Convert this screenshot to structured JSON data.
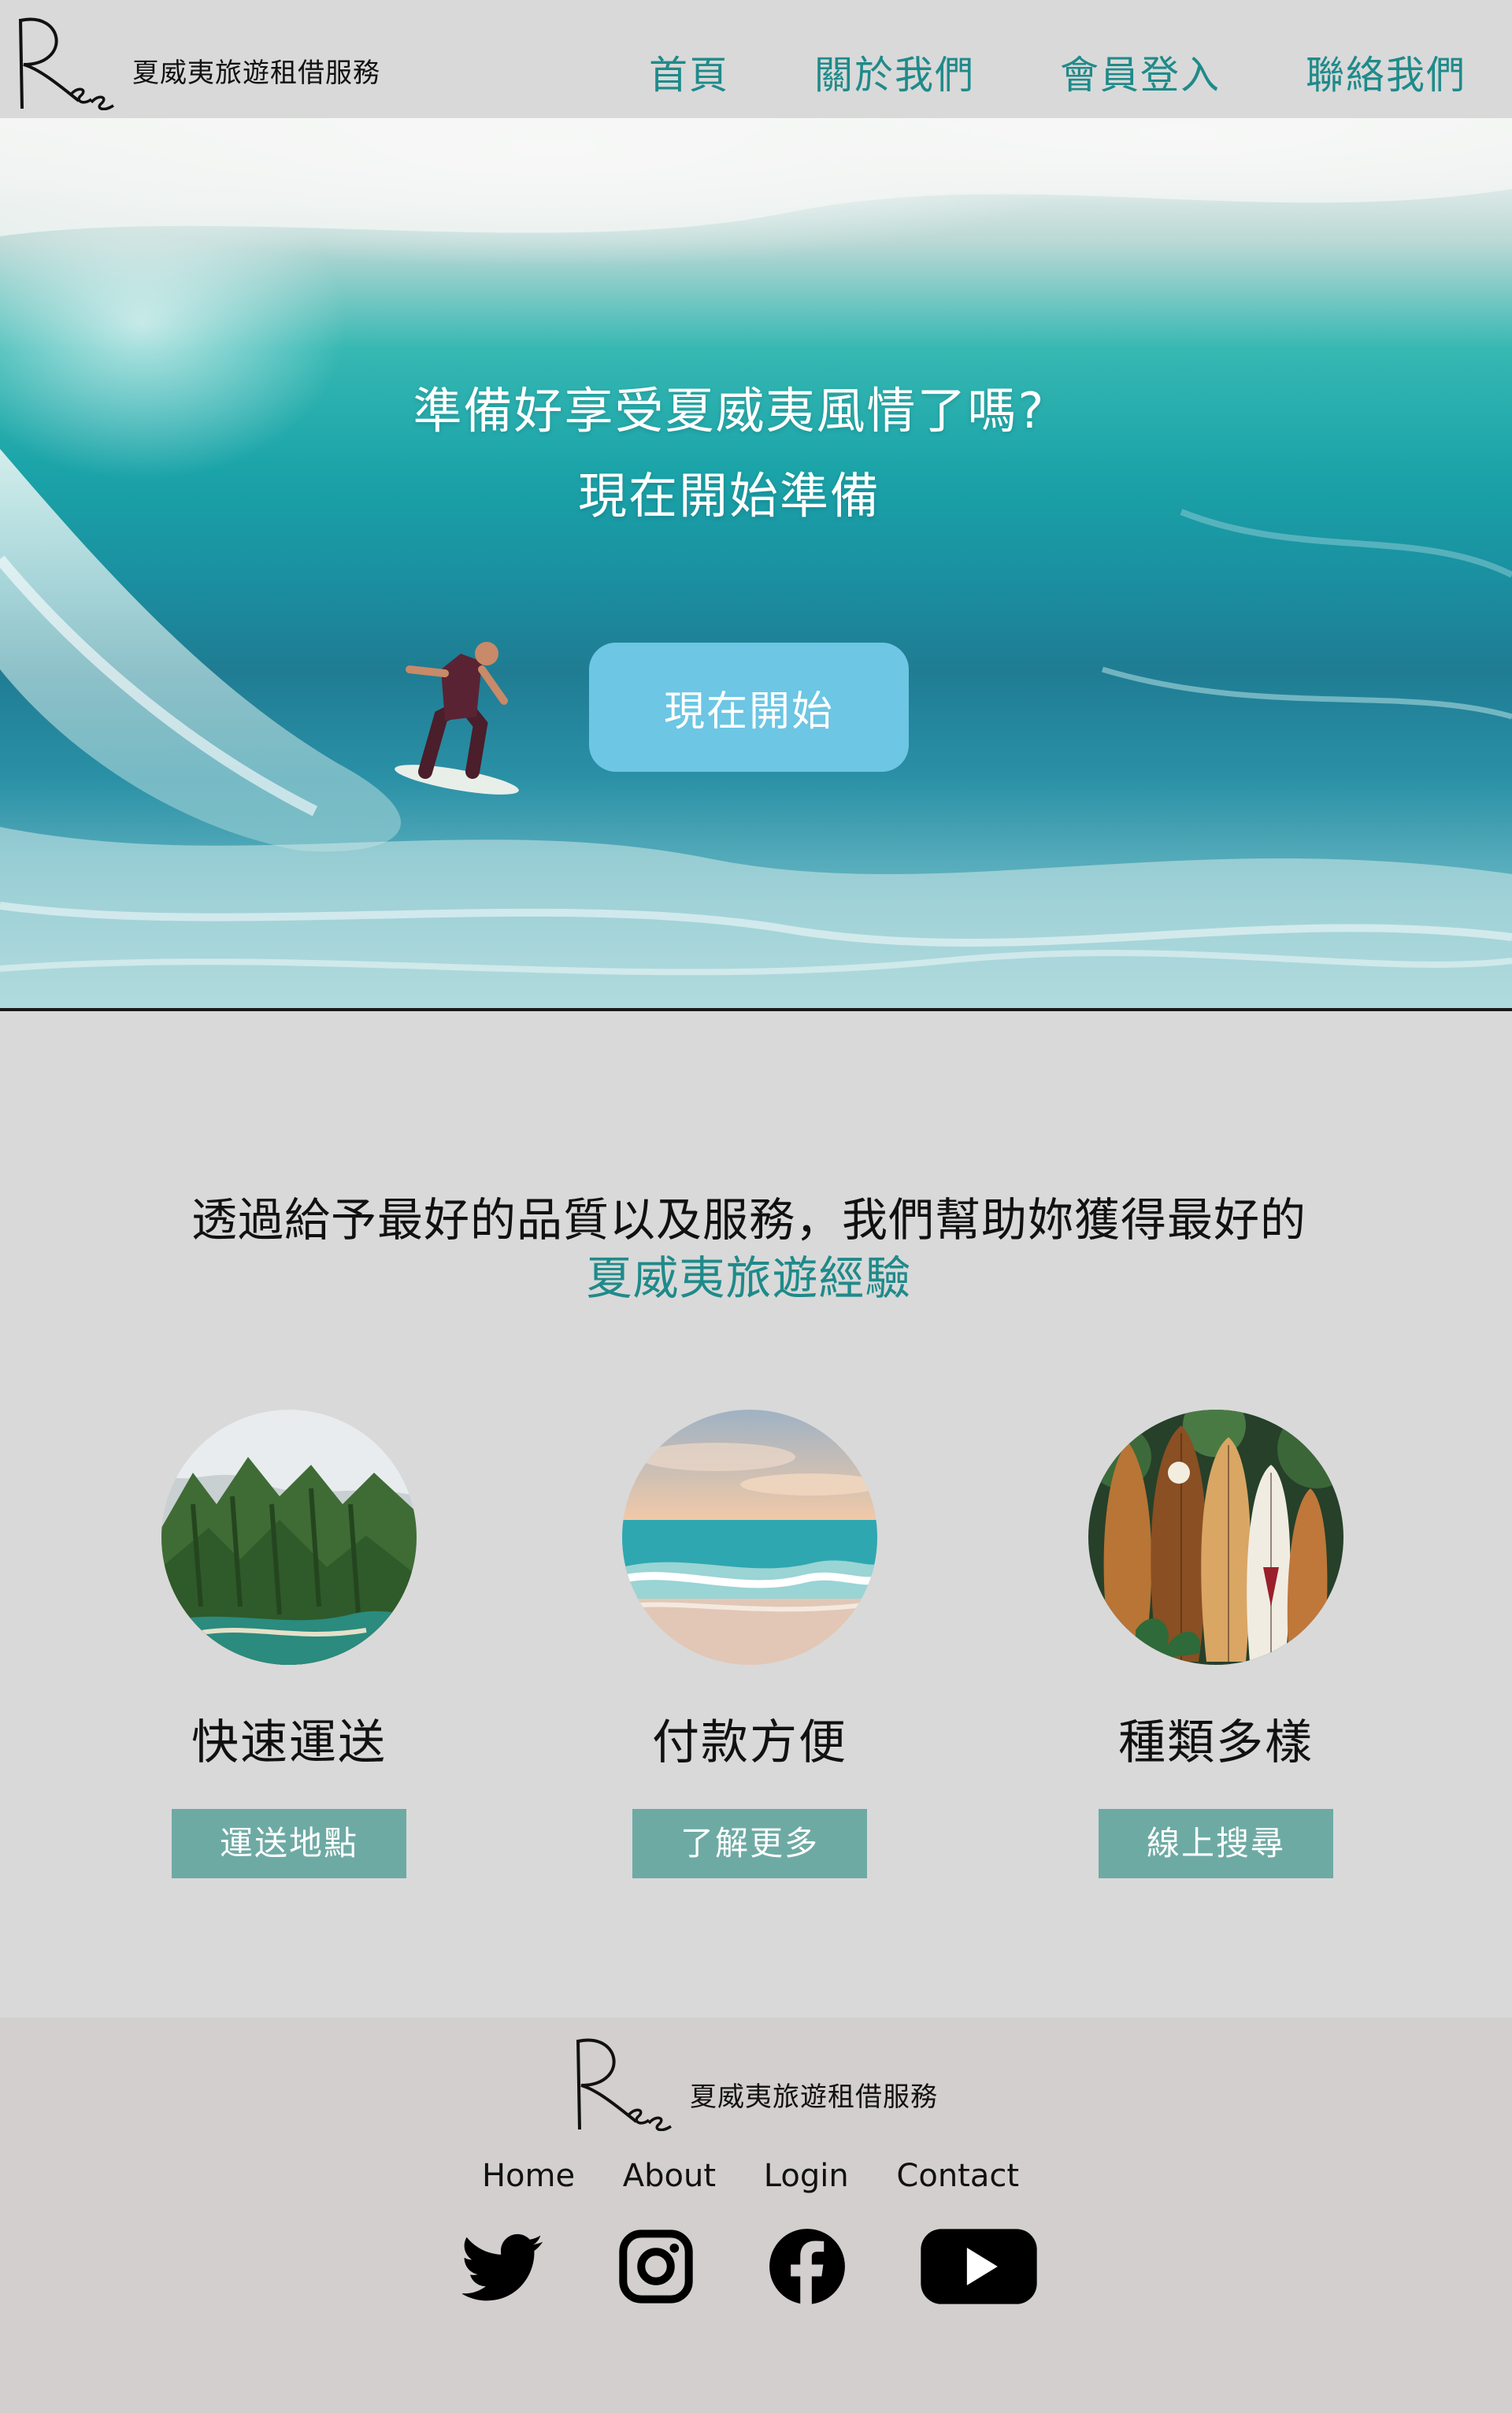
{
  "brand": {
    "name": "夏威夷旅遊租借服務",
    "logo_letter": "R"
  },
  "nav": [
    "首頁",
    "關於我們",
    "會員登入",
    "聯絡我們"
  ],
  "hero": {
    "title_line1": "準備好享受夏威夷風情了嗎?",
    "title_line2": "現在開始準備",
    "cta": "現在開始"
  },
  "intro": {
    "line1": "透過給予最好的品質以及服務，我們幫助妳獲得最好的",
    "line2": "夏威夷旅遊經驗"
  },
  "features": [
    {
      "title": "快速運送",
      "button": "運送地點",
      "image": "mountain-coast"
    },
    {
      "title": "付款方便",
      "button": "了解更多",
      "image": "beach-waves"
    },
    {
      "title": "種類多樣",
      "button": "線上搜尋",
      "image": "surfboards"
    }
  ],
  "footer": {
    "links": [
      "Home",
      "About",
      "Login",
      "Contact"
    ],
    "socials": [
      "twitter-icon",
      "instagram-icon",
      "facebook-icon",
      "youtube-icon"
    ]
  },
  "colors": {
    "accent": "#1f8a8a",
    "hero_button": "#6cc6e4",
    "feature_button": "#6eaaa4",
    "page_bg": "#d9d9d9",
    "footer_bg": "#d3cfcf"
  }
}
